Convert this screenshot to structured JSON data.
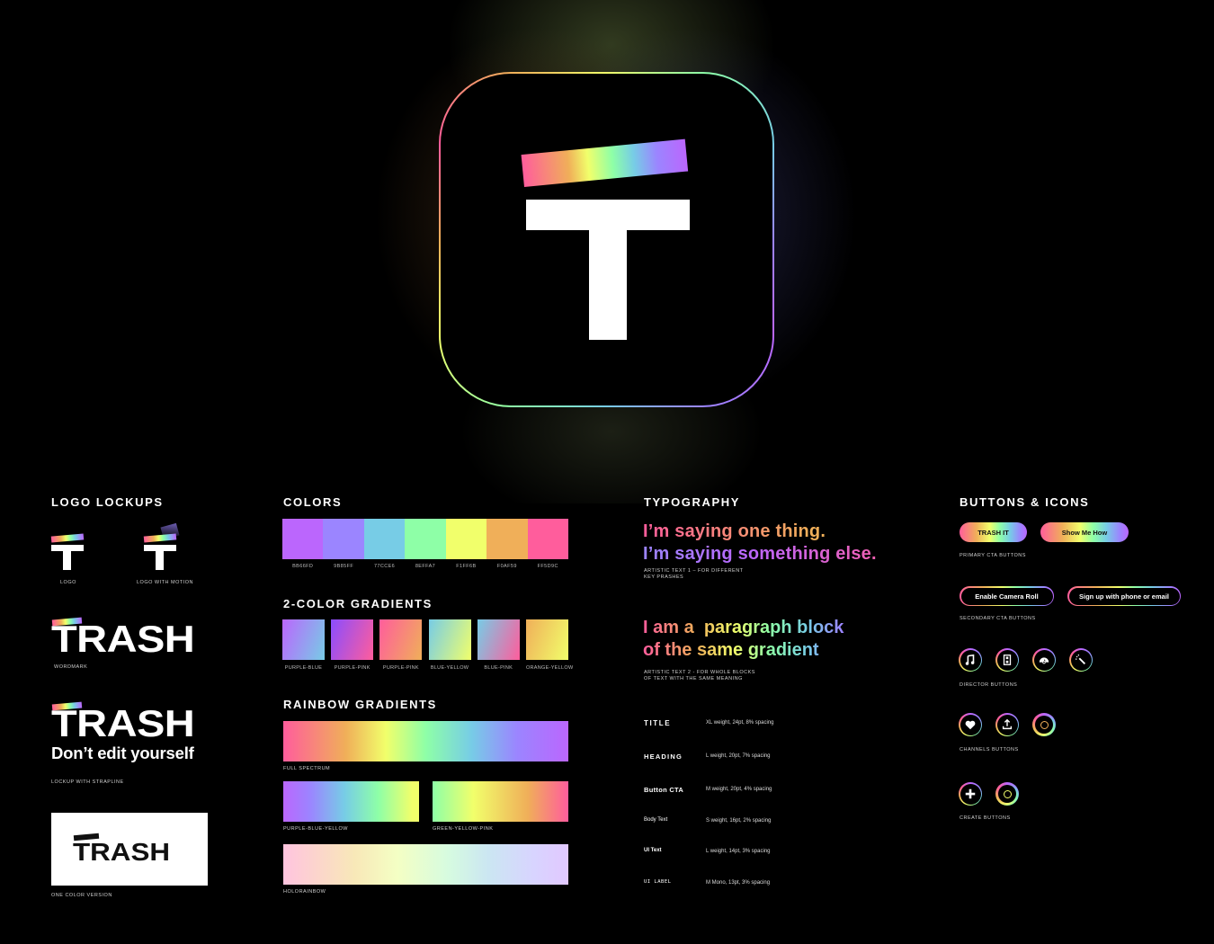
{
  "hero": {
    "icon_letter": "T"
  },
  "logo_lockups": {
    "title": "LOGO LOCKUPS",
    "logo_caption": "LOGO",
    "logo_motion_caption": "LOGO WITH MOTION",
    "wordmark_text": "TRASH",
    "wordmark_caption": "WORDMARK",
    "strapline_word": "TRASH",
    "strapline": "Don’t edit yourself",
    "strapline_caption": "LOCKUP WITH STRAPLINE",
    "one_color_word": "TRASH",
    "one_color_caption": "ONE COLOR VERSION"
  },
  "colors": {
    "title": "COLORS",
    "swatches": [
      {
        "hex": "#BB66FD",
        "label": "BB66FD"
      },
      {
        "hex": "#9B85FF",
        "label": "9B85FF"
      },
      {
        "hex": "#77CCE6",
        "label": "77CCE6"
      },
      {
        "hex": "#8EFFA7",
        "label": "8EFFA7"
      },
      {
        "hex": "#F1FF6B",
        "label": "F1FF6B"
      },
      {
        "hex": "#F0AF59",
        "label": "F0AF59"
      },
      {
        "hex": "#FF5D9C",
        "label": "FF5D9C"
      }
    ]
  },
  "two_color_gradients": {
    "title": "2-COLOR GRADIENTS",
    "items": [
      {
        "label": "PURPLE-BLUE",
        "from": "#BB66FD",
        "to": "#77CCE6"
      },
      {
        "label": "PURPLE-PINK",
        "from": "#8A4DFF",
        "to": "#FF5D9C"
      },
      {
        "label": "PURPLE-PINK",
        "from": "#FF5D9C",
        "to": "#F0AF59"
      },
      {
        "label": "BLUE-YELLOW",
        "from": "#77CCE6",
        "to": "#F1FF6B"
      },
      {
        "label": "BLUE-PINK",
        "from": "#77CCE6",
        "to": "#FF5D9C"
      },
      {
        "label": "ORANGE-YELLOW",
        "from": "#F0AF59",
        "to": "#F1FF6B"
      }
    ]
  },
  "rainbow_gradients": {
    "title": "RAINBOW GRADIENTS",
    "full_spectrum": "FULL SPECTRUM",
    "purple_blue_yellow": "PURPLE-BLUE-YELLOW",
    "green_yellow_pink": "GREEN-YELLOW-PINK",
    "holorainbow": "HOLORAINBOW"
  },
  "typography": {
    "title": "TYPOGRAPHY",
    "artistic1_line1": "I’m saying one thing.",
    "artistic1_line2": "I’m saying something else.",
    "artistic1_caption_1": "ARTISTIC TEXT 1 – FOR DIFFERENT",
    "artistic1_caption_2": "KEY PRASHES",
    "artistic2_line1": "I am a  paragraph block",
    "artistic2_line2": "of the same gradient",
    "artistic2_caption_1": "ARTISTIC TEXT 2 - FOR WHOLE  BLOCKS",
    "artistic2_caption_2": "OF TEXT WITH THE SAME MEANING",
    "styles": [
      {
        "name": "TITLE",
        "spec": "XL weight, 24pt, 8% spacing"
      },
      {
        "name": "HEADING",
        "spec": "L weight, 20pt, 7% spacing"
      },
      {
        "name": "Button CTA",
        "spec": "M weight, 20pt, 4% spacing"
      },
      {
        "name": "Body Text",
        "spec": "S weight, 16pt, 2% spacing"
      },
      {
        "name": "UI Text",
        "spec": "L weight, 14pt, 3% spacing"
      },
      {
        "name": "UI LABEL",
        "spec": "M Mono, 13pt, 3% spacing"
      }
    ]
  },
  "buttons_icons": {
    "title": "BUTTONS & ICONS",
    "primary": [
      "TRASH IT",
      "Show Me How"
    ],
    "primary_caption": "PRIMARY CTA BUTTONS",
    "secondary": [
      "Enable Camera Roll",
      "Sign up with phone or email"
    ],
    "secondary_caption": "SECONDARY CTA BUTTONS",
    "director_icons": [
      "music-note-icon",
      "film-strip-icon",
      "speedometer-icon",
      "magic-wand-icon"
    ],
    "director_caption": "DIRECTOR BUTTONS",
    "channel_icons": [
      "heart-icon",
      "upload-icon",
      "concentric-circles-icon"
    ],
    "channels_caption": "CHANNELS BUTTONS",
    "create_icons": [
      "plus-icon",
      "concentric-circles-icon"
    ],
    "create_caption": "CREATE BUTTONS"
  }
}
